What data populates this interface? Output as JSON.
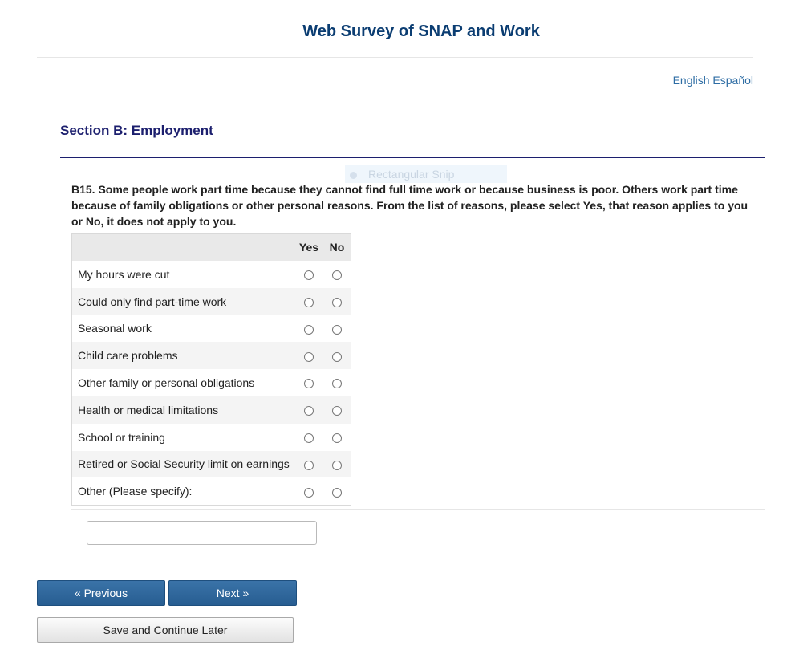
{
  "header": {
    "title": "Web Survey of SNAP and Work"
  },
  "language": {
    "english": "English",
    "espanol": "Español"
  },
  "overlay": {
    "text": "Rectangular Snip"
  },
  "section": {
    "title": "Section B: Employment"
  },
  "question": {
    "text": "B15. Some people work part time because they cannot find full time work or because business is poor. Others work part time because of family obligations or other personal reasons. From the list of reasons, please select Yes, that reason applies to you or No, it does not apply to you."
  },
  "grid": {
    "yes_label": "Yes",
    "no_label": "No",
    "rows": [
      {
        "label": "My hours were cut"
      },
      {
        "label": "Could only find part-time work"
      },
      {
        "label": "Seasonal work"
      },
      {
        "label": "Child care problems"
      },
      {
        "label": "Other family or personal obligations"
      },
      {
        "label": "Health or medical limitations"
      },
      {
        "label": "School or training"
      },
      {
        "label": "Retired or Social Security limit on earnings"
      },
      {
        "label": "Other (Please specify):"
      }
    ]
  },
  "specify": {
    "value": "",
    "placeholder": ""
  },
  "nav": {
    "previous_label": "« Previous",
    "next_label": "Next »",
    "save_label": "Save and Continue Later"
  },
  "colors": {
    "title": "#0b3d72",
    "section": "#1c1f6e",
    "link": "#2e6da4",
    "button_primary": "#2e659a"
  }
}
